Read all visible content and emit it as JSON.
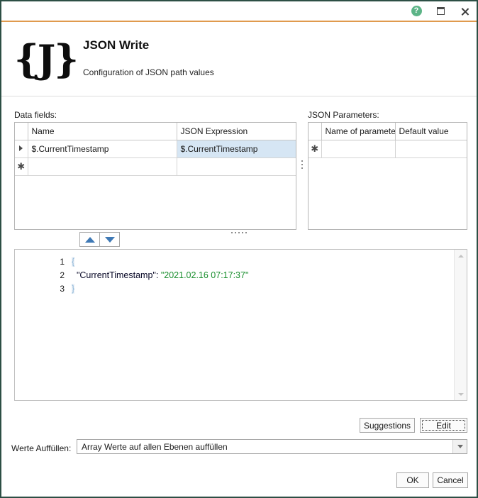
{
  "window": {
    "border_color": "#2c4f45",
    "accent_rule_color": "#e09a4e"
  },
  "titlebar": {
    "help_label": "?",
    "help_color": "#5cb487",
    "maximize_label": "",
    "close_label": ""
  },
  "banner": {
    "logo_text": "{J}",
    "title": "JSON Write",
    "subtitle": "Configuration of JSON path values"
  },
  "data_fields": {
    "label": "Data fields:",
    "columns": [
      "Name",
      "JSON Expression"
    ],
    "rows": [
      {
        "indicator": "current",
        "name": "$.CurrentTimestamp",
        "expression": "$.CurrentTimestamp",
        "expression_selected": true
      },
      {
        "indicator": "new",
        "name": "",
        "expression": "",
        "expression_selected": false
      }
    ],
    "selection_color": "#d6e6f4"
  },
  "json_parameters": {
    "label": "JSON Parameters:",
    "columns": [
      "Name of parameter",
      "Default value"
    ],
    "rows": [
      {
        "indicator": "new",
        "parameter": "",
        "default_value": ""
      }
    ]
  },
  "move_buttons": {
    "up_label": "Move up",
    "down_label": "Move down",
    "arrow_color": "#3f79b5"
  },
  "editor": {
    "lines": [
      {
        "number": "1",
        "tokens": [
          {
            "text": "{",
            "type": "brace"
          }
        ]
      },
      {
        "number": "2",
        "tokens": [
          {
            "text": "  ",
            "type": "plain"
          },
          {
            "text": "\"CurrentTimestamp\"",
            "type": "key"
          },
          {
            "text": ": ",
            "type": "punct"
          },
          {
            "text": "\"2021.02.16 07:17:37\"",
            "type": "string"
          }
        ]
      },
      {
        "number": "3",
        "tokens": [
          {
            "text": "}",
            "type": "brace"
          }
        ]
      }
    ],
    "string_color": "#1a8f2e",
    "key_color": "#0a0a28",
    "brace_color": "#8fb8d8"
  },
  "actions": {
    "suggestions_label": "Suggestions",
    "edit_label": "Edit",
    "edit_focused": true
  },
  "fill_values": {
    "label": "Werte Auffüllen:",
    "selected": "Array Werte auf allen Ebenen auffüllen"
  },
  "dialog_buttons": {
    "ok_label": "OK",
    "cancel_label": "Cancel"
  }
}
